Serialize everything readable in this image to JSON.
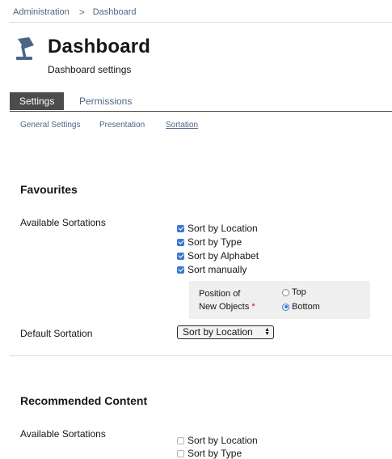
{
  "breadcrumb": {
    "items": [
      "Administration",
      "Dashboard"
    ],
    "separator": ">"
  },
  "header": {
    "title": "Dashboard",
    "subtitle": "Dashboard settings",
    "icon": "lamp-icon"
  },
  "tabs": [
    {
      "label": "Settings",
      "active": true
    },
    {
      "label": "Permissions",
      "active": false
    }
  ],
  "subtabs": [
    {
      "label": "General Settings",
      "current": false
    },
    {
      "label": "Presentation",
      "current": false
    },
    {
      "label": "Sortation",
      "current": true
    }
  ],
  "favourites": {
    "title": "Favourites",
    "available_label": "Available Sortations",
    "options": [
      {
        "label": "Sort by Location",
        "checked": true
      },
      {
        "label": "Sort by Type",
        "checked": true
      },
      {
        "label": "Sort by Alphabet",
        "checked": true
      },
      {
        "label": "Sort manually",
        "checked": true
      }
    ],
    "position": {
      "label_line1": "Position of",
      "label_line2": "New Objects",
      "required_mark": "*",
      "options": [
        {
          "label": "Top",
          "selected": false
        },
        {
          "label": "Bottom",
          "selected": true
        }
      ]
    },
    "default_label": "Default Sortation",
    "default_value": "Sort by Location"
  },
  "recommended": {
    "title": "Recommended Content",
    "available_label": "Available Sortations",
    "options": [
      {
        "label": "Sort by Location",
        "checked": false
      },
      {
        "label": "Sort by Type",
        "checked": false
      }
    ]
  },
  "colors": {
    "link": "#4c6586",
    "accent": "#3b76d1",
    "tab_active_bg": "#4c4c4c",
    "panel_bg": "#efefef",
    "required": "#d0021b"
  }
}
